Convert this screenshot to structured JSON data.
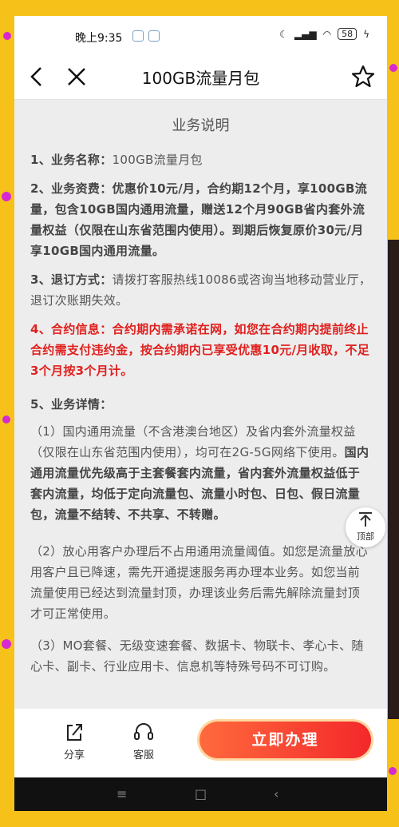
{
  "status_bar": {
    "time": "晚上9:35",
    "battery": "58"
  },
  "nav": {
    "title": "100GB流量月包"
  },
  "content": {
    "section_title": "业务说明",
    "items": [
      {
        "label": "1、业务名称：",
        "text": "100GB流量月包"
      },
      {
        "label": "2、业务资费：",
        "text": "优惠价10元/月，合约期12个月，享100GB流量，包含10GB国内通用流量，赠送12个月90GB省内套外流量权益（仅限在山东省范围内使用）。到期后恢复原价30元/月享10GB国内通用流量。"
      },
      {
        "label": "3、退订方式：",
        "text": "请拨打客服热线10086或咨询当地移动营业厅，退订次账期失效。"
      },
      {
        "label": "4、合约信息：",
        "text": "合约期内需承诺在网，如您在合约期内提前终止合约需支付违约金，按合约期内已享受优惠10元/月收取，不足3个月按3个月计。"
      },
      {
        "label": "5、业务详情：",
        "text": ""
      }
    ],
    "detail_1_plain": "（1）国内通用流量（不含港澳台地区）及省内套外流量权益（仅限在山东省范围内使用），均可在2G-5G网络下使用。",
    "detail_1_bold": "国内通用流量优先级高于主套餐套内流量，省内套外流量权益低于套内流量，均低于定向流量包、流量小时包、日包、假日流量包，流量不结转、不共享、不转赠。",
    "detail_2": "（2）放心用客户办理后不占用通用流量阈值。如您是流量放心用客户且已降速，需先开通提速服务再办理本业务。如您当前流量使用已经达到流量封顶，办理该业务后需先解除流量封顶才可正常使用。",
    "detail_3": "（3）MO套餐、无级变速套餐、数据卡、物联卡、孝心卡、随心卡、副卡、行业应用卡、信息机等特殊号码不可订购。"
  },
  "floating": {
    "top_label": "顶部"
  },
  "bottom_bar": {
    "share_label": "分享",
    "service_label": "客服",
    "apply_label": "立即办理"
  }
}
